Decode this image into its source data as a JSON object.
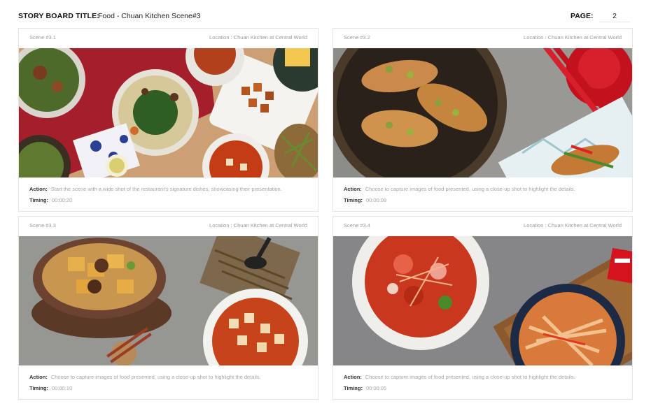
{
  "header": {
    "storyboard_label": "STORY BOARD TITLE:",
    "storyboard_title": "Food - Chuan Kitchen Scene#3",
    "page_label": "PAGE:",
    "page_number": "2"
  },
  "labels": {
    "action": "Action:",
    "timing": "Timing:"
  },
  "scenes": [
    {
      "scene": "Scene #3.1",
      "location": "Location : Chuan Kitchen at Central World",
      "action": "Start the scene with a wide shot of the restaurant's signature dishes, showcasing their presentation.",
      "timing": "00:00:20",
      "image": "photo-overhead-spread-of-signature-dishes"
    },
    {
      "scene": "Scene #3.2",
      "location": "Location : Chuan Kitchen at Central World",
      "action": "Choose to capture images of food presented, using a close-up shot to highlight the details.",
      "timing": "00:00:08",
      "image": "photo-fried-fish-with-pickled-greens"
    },
    {
      "scene": "Scene #3.3",
      "location": "Location : Chuan Kitchen at Central World",
      "action": "Choose to capture images of food presented, using a close-up shot to highlight the details.",
      "timing": "00:00:10",
      "image": "photo-claypot-tofu-and-mapo-tofu"
    },
    {
      "scene": "Scene #3.4",
      "location": "Location : Chuan Kitchen at Central World",
      "action": "Choose to capture images of food presented, using a close-up shot to highlight the details.",
      "timing": "00:00:05",
      "image": "photo-spicy-salad-and-chili-noodles"
    }
  ]
}
